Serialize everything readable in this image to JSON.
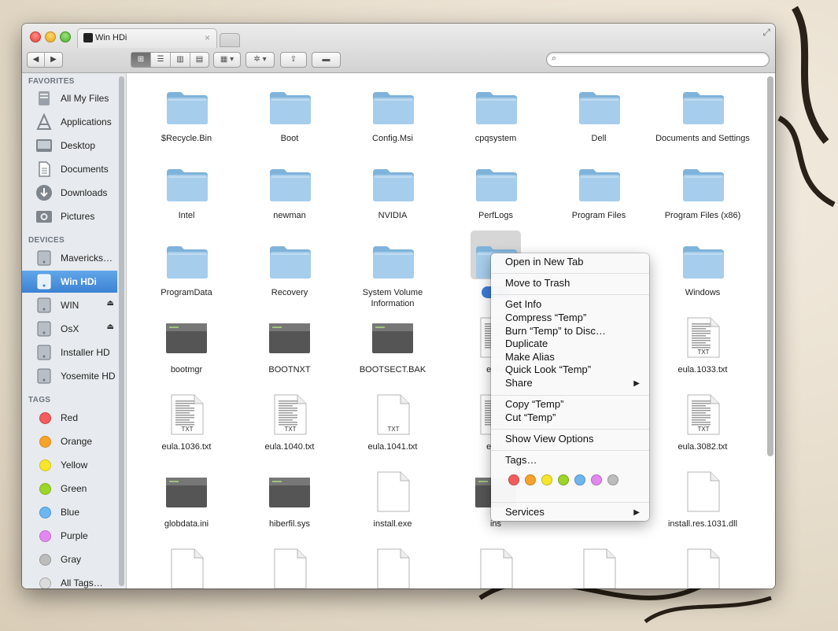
{
  "window": {
    "tab_title": "Win HDi",
    "tab_close": "×"
  },
  "toolbar": {
    "back": "◀",
    "forward": "▶",
    "view_icon": "icon-view-button",
    "view_list": "list-view-button",
    "view_column": "column-view-button",
    "view_coverflow": "coverflow-view-button",
    "arrange": "arrange-button",
    "action": "action-gear-button",
    "share": "share-button",
    "tags": "tags-button",
    "search_placeholder": ""
  },
  "sidebar": {
    "favorites_header": "FAVORITES",
    "favorites": [
      {
        "label": "All My Files",
        "icon": "all-files-icon"
      },
      {
        "label": "Applications",
        "icon": "applications-icon"
      },
      {
        "label": "Desktop",
        "icon": "desktop-icon"
      },
      {
        "label": "Documents",
        "icon": "documents-icon"
      },
      {
        "label": "Downloads",
        "icon": "downloads-icon"
      },
      {
        "label": "Pictures",
        "icon": "pictures-icon"
      }
    ],
    "devices_header": "DEVICES",
    "devices": [
      {
        "label": "Mavericks…",
        "eject": false
      },
      {
        "label": "Win HDi",
        "eject": false,
        "selected": true
      },
      {
        "label": "WIN",
        "eject": true
      },
      {
        "label": "OsX",
        "eject": true
      },
      {
        "label": "Installer HD",
        "eject": false
      },
      {
        "label": "Yosemite HD",
        "eject": false
      }
    ],
    "tags_header": "TAGS",
    "tags": [
      {
        "label": "Red",
        "color": "#f25d5d"
      },
      {
        "label": "Orange",
        "color": "#f7a32a"
      },
      {
        "label": "Yellow",
        "color": "#f6e62a"
      },
      {
        "label": "Green",
        "color": "#9dd42a"
      },
      {
        "label": "Blue",
        "color": "#6cb6f2"
      },
      {
        "label": "Purple",
        "color": "#e388f0"
      },
      {
        "label": "Gray",
        "color": "#bcbcbc"
      },
      {
        "label": "All Tags…",
        "color": "#dcdcdc"
      }
    ]
  },
  "files": [
    {
      "name": "$Recycle.Bin",
      "kind": "folder"
    },
    {
      "name": "Boot",
      "kind": "folder"
    },
    {
      "name": "Config.Msi",
      "kind": "folder"
    },
    {
      "name": "cpqsystem",
      "kind": "folder"
    },
    {
      "name": "Dell",
      "kind": "folder"
    },
    {
      "name": "Documents and Settings",
      "kind": "folder"
    },
    {
      "name": "Intel",
      "kind": "folder"
    },
    {
      "name": "newman",
      "kind": "folder"
    },
    {
      "name": "NVIDIA",
      "kind": "folder"
    },
    {
      "name": "PerfLogs",
      "kind": "folder"
    },
    {
      "name": "Program Files",
      "kind": "folder"
    },
    {
      "name": "Program Files (x86)",
      "kind": "folder"
    },
    {
      "name": "ProgramData",
      "kind": "folder"
    },
    {
      "name": "Recovery",
      "kind": "folder"
    },
    {
      "name": "System Volume Information",
      "kind": "folder"
    },
    {
      "name": "T",
      "kind": "folder",
      "selected": true
    },
    {
      "name": "",
      "kind": "folder",
      "hidden": true
    },
    {
      "name": "Windows",
      "kind": "folder"
    },
    {
      "name": "bootmgr",
      "kind": "exec"
    },
    {
      "name": "BOOTNXT",
      "kind": "exec"
    },
    {
      "name": "BOOTSECT.BAK",
      "kind": "exec"
    },
    {
      "name": "eula.",
      "kind": "txt"
    },
    {
      "name": "",
      "kind": "txt",
      "hidden": true
    },
    {
      "name": "eula.1033.txt",
      "kind": "txt"
    },
    {
      "name": "eula.1036.txt",
      "kind": "txt"
    },
    {
      "name": "eula.1040.txt",
      "kind": "txt"
    },
    {
      "name": "eula.1041.txt",
      "kind": "blank-txt"
    },
    {
      "name": "eula.",
      "kind": "txt"
    },
    {
      "name": "",
      "kind": "txt",
      "hidden": true
    },
    {
      "name": "eula.3082.txt",
      "kind": "txt"
    },
    {
      "name": "globdata.ini",
      "kind": "exec"
    },
    {
      "name": "hiberfil.sys",
      "kind": "exec"
    },
    {
      "name": "install.exe",
      "kind": "blank"
    },
    {
      "name": "ins",
      "kind": "exec"
    },
    {
      "name": "",
      "kind": "blank",
      "hidden": true
    },
    {
      "name": "install.res.1031.dll",
      "kind": "blank"
    },
    {
      "name": "",
      "kind": "blank"
    },
    {
      "name": "",
      "kind": "blank"
    },
    {
      "name": "",
      "kind": "blank"
    },
    {
      "name": "",
      "kind": "blank"
    },
    {
      "name": "",
      "kind": "blank"
    },
    {
      "name": "",
      "kind": "blank"
    }
  ],
  "doc_badge": "TXT",
  "context_menu": {
    "open_new_tab": "Open in New Tab",
    "move_to_trash": "Move to Trash",
    "get_info": "Get Info",
    "compress": "Compress “Temp”",
    "burn": "Burn “Temp” to Disc…",
    "duplicate": "Duplicate",
    "make_alias": "Make Alias",
    "quick_look": "Quick Look “Temp”",
    "share": "Share",
    "copy": "Copy “Temp”",
    "cut": "Cut “Temp”",
    "show_view_options": "Show View Options",
    "tags": "Tags…",
    "services": "Services",
    "submenu_arrow": "▶",
    "tag_colors": [
      "#f25d5d",
      "#f7a32a",
      "#f6e62a",
      "#9dd42a",
      "#6cb6f2",
      "#e388f0",
      "#bcbcbc"
    ]
  }
}
